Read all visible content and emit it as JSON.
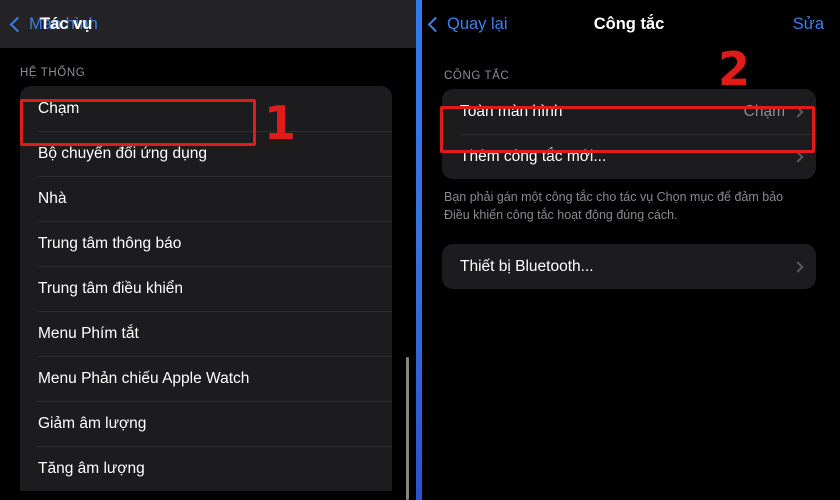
{
  "left_panel": {
    "navbar": {
      "back_label": "Màn hình",
      "back_icon": "chevron-left-icon",
      "title": "Tác vụ"
    },
    "section_header": "HỆ THỐNG",
    "items": [
      {
        "label": "Chạm"
      },
      {
        "label": "Bộ chuyển đổi ứng dụng"
      },
      {
        "label": "Nhà"
      },
      {
        "label": "Trung tâm thông báo"
      },
      {
        "label": "Trung tâm điều khiển"
      },
      {
        "label": "Menu Phím tắt"
      },
      {
        "label": "Menu Phản chiếu Apple Watch"
      },
      {
        "label": "Giảm âm lượng"
      },
      {
        "label": "Tăng âm lượng"
      }
    ]
  },
  "right_panel": {
    "navbar": {
      "back_label": "Quay lại",
      "back_icon": "chevron-left-icon",
      "title": "Công tắc",
      "action_label": "Sửa"
    },
    "section_header": "CÔNG TẮC",
    "switch_items": [
      {
        "label": "Toàn màn hình",
        "value": "Chạm",
        "chevron": "chevron-right-icon"
      },
      {
        "label": "Thêm công tắc mới...",
        "value": "",
        "chevron": "chevron-right-icon"
      }
    ],
    "footnote": "Bạn phải gán một công tắc cho tác vụ Chọn mục để đảm bảo Điều khiển công tắc hoạt động đúng cách.",
    "bluetooth_items": [
      {
        "label": "Thiết bị Bluetooth...",
        "value": "",
        "chevron": "chevron-right-icon"
      }
    ]
  },
  "annotations": {
    "step_one": "1",
    "step_two": "2",
    "highlight_color": "#e01b1b"
  },
  "colors": {
    "accent_blue": "#3e80ea",
    "divider_blue": "#2e7bf0",
    "card_bg": "#1c1c1e",
    "navbar_left_bg": "#242426",
    "secondary_text": "#8e8e93"
  }
}
